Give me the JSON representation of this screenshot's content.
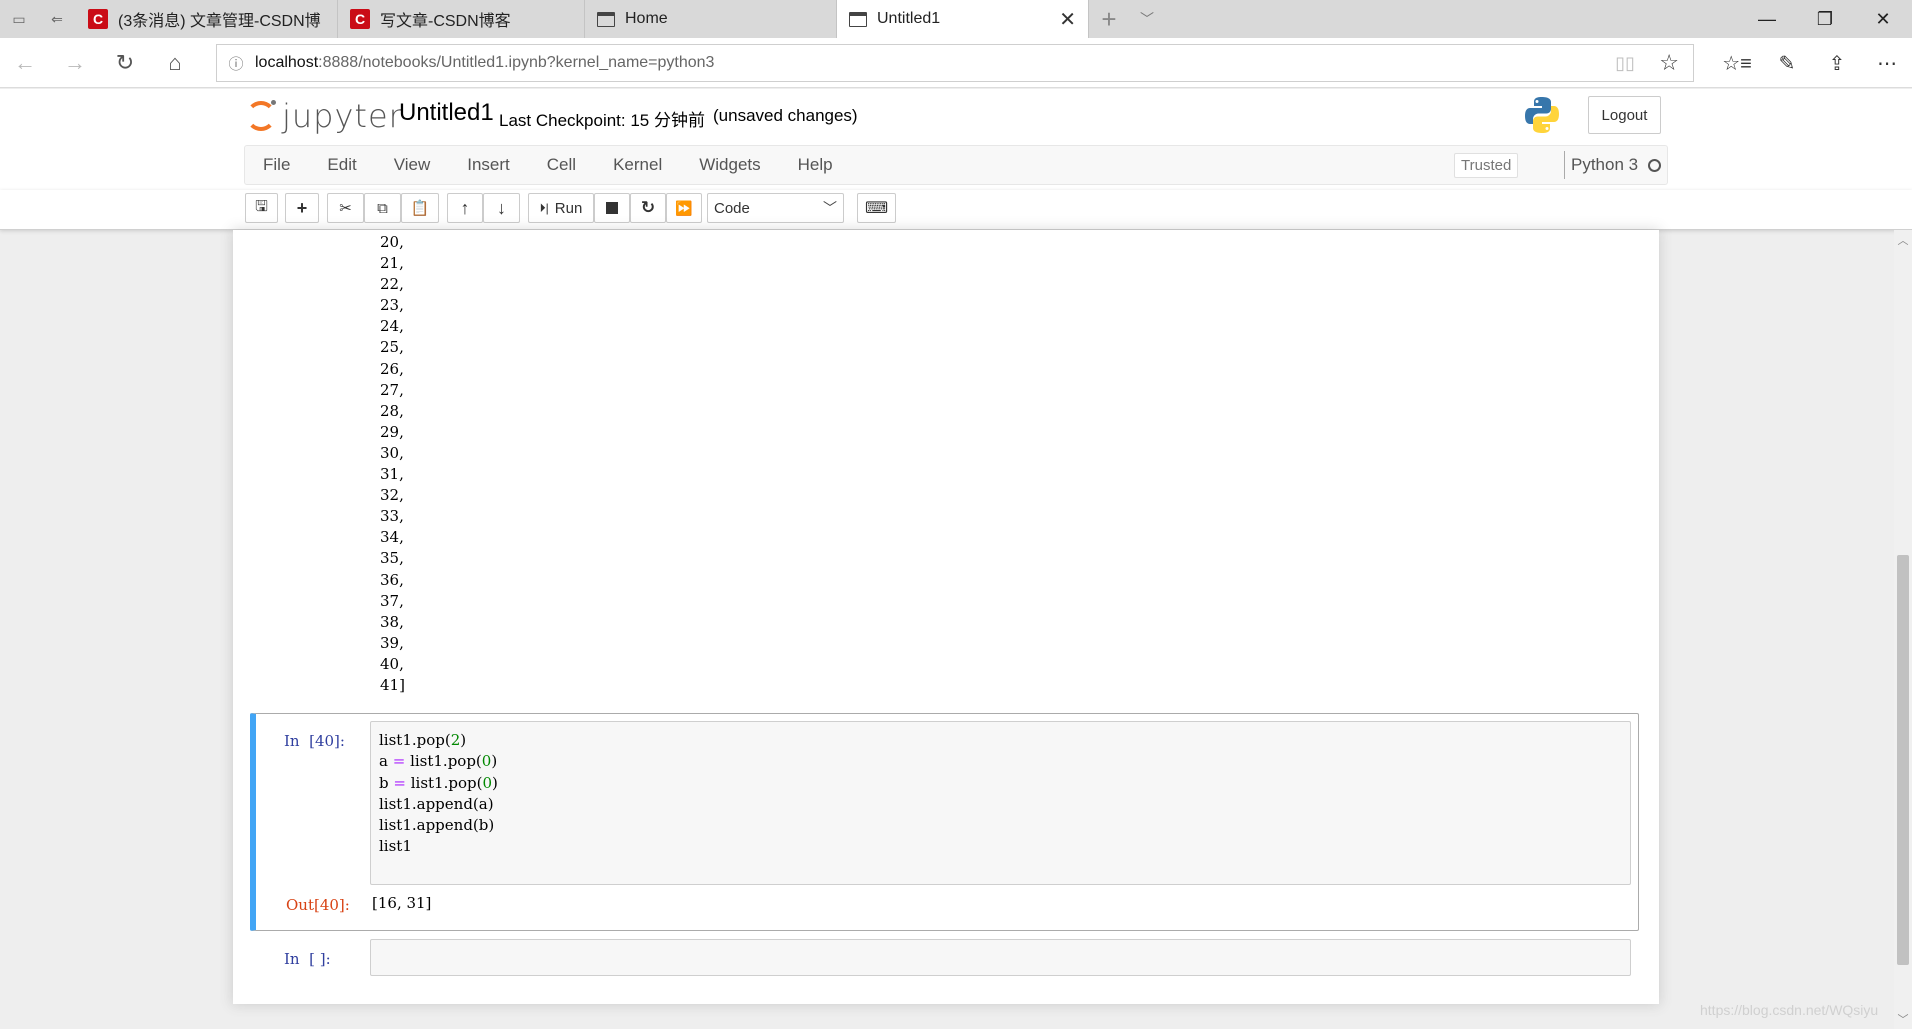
{
  "browser": {
    "tabs": [
      {
        "label": "(3条消息) 文章管理-CSDN博",
        "icon": "csdn-icon"
      },
      {
        "label": "写文章-CSDN博客",
        "icon": "csdn-icon"
      },
      {
        "label": "Home",
        "icon": "page-icon"
      },
      {
        "label": "Untitled1",
        "icon": "page-icon",
        "active": true
      }
    ],
    "url_host": "localhost",
    "url_rest": ":8888/notebooks/Untitled1.ipynb?kernel_name=python3"
  },
  "jupyter": {
    "logo_text": "jupyter",
    "notebook_name": "Untitled1",
    "checkpoint": "Last Checkpoint: 15 分钟前",
    "unsaved": "(unsaved changes)",
    "logout_label": "Logout",
    "menu": [
      "File",
      "Edit",
      "View",
      "Insert",
      "Cell",
      "Kernel",
      "Widgets",
      "Help"
    ],
    "trusted_label": "Trusted",
    "kernel_name": "Python 3",
    "run_label": "Run",
    "cell_type": "Code"
  },
  "notebook": {
    "scrolled_output": [
      "20,",
      "21,",
      "22,",
      "23,",
      "24,",
      "25,",
      "26,",
      "27,",
      "28,",
      "29,",
      "30,",
      "31,",
      "32,",
      "33,",
      "34,",
      "35,",
      "36,",
      "37,",
      "38,",
      "39,",
      "40,",
      "41]"
    ],
    "cell40": {
      "in_prompt": "In  [40]:",
      "out_prompt": "Out[40]:",
      "output": "[16, 31]"
    },
    "empty_cell_prompt": "In  [ ]:"
  },
  "watermark": "https://blog.csdn.net/WQsiyu",
  "colors": {
    "selected_cell_border": "#42a5f5",
    "jupyter_orange": "#f37726",
    "in_prompt": "#303f9f",
    "out_prompt": "#d84315"
  }
}
